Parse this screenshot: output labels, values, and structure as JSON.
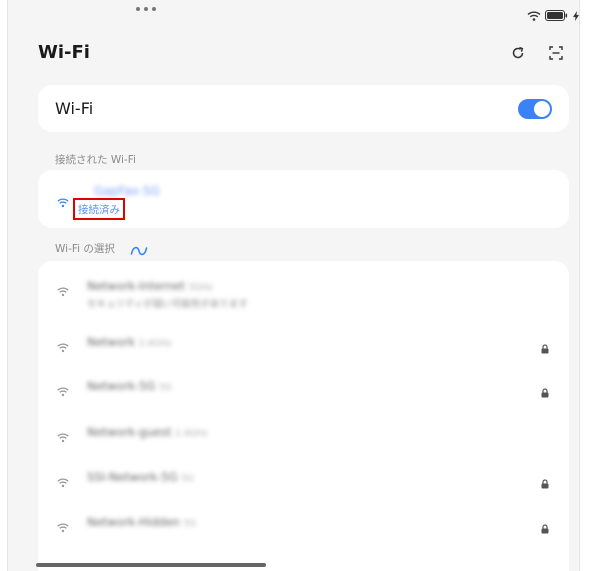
{
  "statusbar": {
    "dots": 3
  },
  "page": {
    "title": "Wi-Fi"
  },
  "actions": [
    {
      "name": "refresh-icon"
    },
    {
      "name": "scan-icon"
    }
  ],
  "wifi_toggle": {
    "label": "Wi-Fi",
    "enabled": true
  },
  "connected_section": {
    "label": "接続された Wi-Fi",
    "network": {
      "ssid": "GapFax-5G",
      "status": "接続済み"
    }
  },
  "select_section": {
    "label": "Wi-Fi の選択"
  },
  "networks": [
    {
      "ssid": "Network-Internet",
      "detail": "5GHz",
      "sub": "セキュリティが弱い可能性があります",
      "locked": false
    },
    {
      "ssid": "Network",
      "detail": "2.4GHz",
      "sub": "",
      "locked": true
    },
    {
      "ssid": "Network-5G",
      "detail": "5G",
      "sub": "",
      "locked": true
    },
    {
      "ssid": "Network-guest",
      "detail": "2.4GHz",
      "sub": "",
      "locked": false
    },
    {
      "ssid": "SSI-Network-5G",
      "detail": "5G",
      "sub": "",
      "locked": true
    },
    {
      "ssid": "Network-Hidden",
      "detail": "5G",
      "sub": "",
      "locked": true
    }
  ],
  "colors": {
    "accent": "#3b82f6",
    "highlight": "#e00000"
  }
}
